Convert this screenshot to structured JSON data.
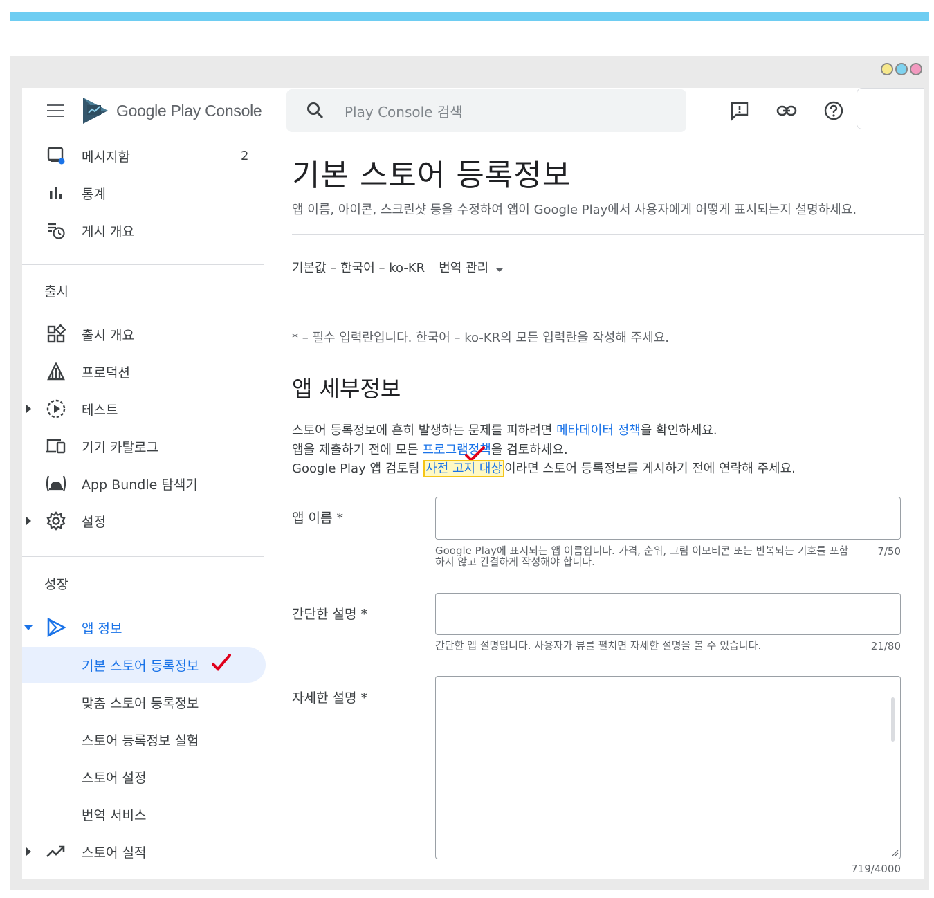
{
  "window": {
    "dot_colors": [
      "#f6e88c",
      "#7fd3f0",
      "#f39ac0"
    ]
  },
  "header": {
    "logo_text_1": "Google Play",
    "logo_text_2": " Console",
    "search_placeholder": "Play Console 검색"
  },
  "sidebar": {
    "top_items": [
      {
        "label": "메시지함",
        "count": "2",
        "icon": "inbox-icon"
      },
      {
        "label": "통계",
        "icon": "bar-chart-icon"
      },
      {
        "label": "게시 개요",
        "icon": "publishing-overview-icon"
      }
    ],
    "section_release": "출시",
    "release_items": [
      {
        "label": "출시 개요",
        "icon": "dashboard-icon"
      },
      {
        "label": "프로덕션",
        "icon": "production-icon"
      },
      {
        "label": "테스트",
        "icon": "testing-icon"
      },
      {
        "label": "기기 카탈로그",
        "icon": "devices-icon"
      },
      {
        "label": "App Bundle 탐색기",
        "icon": "android-icon"
      },
      {
        "label": "설정",
        "icon": "gear-icon"
      }
    ],
    "section_grow": "성장",
    "grow_parent": {
      "label": "앱 정보",
      "icon": "play-icon"
    },
    "grow_items": [
      {
        "label": "기본 스토어 등록정보"
      },
      {
        "label": "맞춤 스토어 등록정보"
      },
      {
        "label": "스토어 등록정보 실험"
      },
      {
        "label": "스토어 설정"
      },
      {
        "label": "번역 서비스"
      }
    ],
    "store_performance": {
      "label": "스토어 실적",
      "icon": "trending-up-icon"
    }
  },
  "main": {
    "title": "기본 스토어 등록정보",
    "description": "앱 이름, 아이콘, 스크린샷 등을 수정하여 앱이 Google Play에서 사용자에게 어떻게 표시되는지 설명하세요.",
    "language": "기본값 – 한국어 – ko-KR",
    "manage_translations": "번역 관리",
    "required_note": "* – 필수 입력란입니다. 한국어 – ko-KR의 모든 입력란을 작성해 주세요.",
    "section_title": "앱 세부정보",
    "info1_pre": "스토어 등록정보에 흔히 발생하는 문제를 피하려면 ",
    "info1_link": "메타데이터 정책",
    "info1_post": "을 확인하세요.",
    "info2_pre": "앱을 제출하기 전에 모든 ",
    "info2_link": "프로그램정책",
    "info2_post": "을 검토하세요.",
    "info3_pre": "Google Play 앱 검토팀 ",
    "info3_link": "사전 고지 대상",
    "info3_post": "이라면 스토어 등록정보를 게시하기 전에 연락해 주세요.",
    "fields": {
      "app_name": {
        "label": "앱 이름 *",
        "value": "",
        "helper": "Google Play에 표시되는 앱 이름입니다. 가격, 순위, 그림 이모티콘 또는 반복되는 기호를 포함하지 않고 간결하게 작성해야 합니다.",
        "counter": "7/50"
      },
      "short_desc": {
        "label": "간단한 설명 *",
        "value": "",
        "helper": "간단한 앱 설명입니다. 사용자가 뷰를 펼치면 자세한 설명을 볼 수 있습니다.",
        "counter": "21/80"
      },
      "full_desc": {
        "label": "자세한 설명 *",
        "value": "",
        "counter": "719/4000"
      }
    }
  }
}
